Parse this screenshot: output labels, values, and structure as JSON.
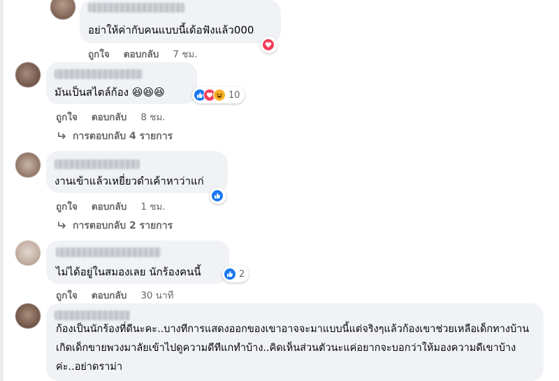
{
  "comments": [
    {
      "text": "อย่าให้ค่ากับคนแบบนี้เด้อฟังแล้ว000",
      "like_label": "ถูกใจ",
      "reply_label": "ตอบกลับ",
      "time": "7 ชม.",
      "reactions": {
        "icons": [
          "love-icon"
        ],
        "count": ""
      }
    },
    {
      "text": "มันเป็นสไตล์ก้อง 😆😆😆",
      "like_label": "ถูกใจ",
      "reply_label": "ตอบกลับ",
      "time": "8 ชม.",
      "reactions": {
        "icons": [
          "like-icon",
          "love-icon",
          "haha-icon"
        ],
        "count": "10"
      },
      "replies_label": "การตอบกลับ 4 รายการ"
    },
    {
      "text": "งานเข้าแล้วเหยี่ยวดำเค้าหาว่าแก่",
      "like_label": "ถูกใจ",
      "reply_label": "ตอบกลับ",
      "time": "1 ชม.",
      "reactions": {
        "icons": [
          "like-icon"
        ],
        "count": ""
      },
      "replies_label": "การตอบกลับ 2 รายการ"
    },
    {
      "text": "ไม่ได้อยู่ในสมองเลย นักร้องคนนี้",
      "like_label": "ถูกใจ",
      "reply_label": "ตอบกลับ",
      "time": "30 นาที",
      "reactions": {
        "icons": [
          "like-icon"
        ],
        "count": "2"
      }
    },
    {
      "text": "ก้องเป็นนักร้องที่ดีนะคะ..บางทีการแสดงออกของเขาอาจจะมาแบบนี้แต่จริงๆแล้วก้องเขาช่วยเหลือเด็กทางบ้านเกิดเด็กขายพวงมาลัยเข้าไปดูความดีทีแกทำบ้าง..คิดเห็นส่วนตัวนะแค่อยากจะบอกว่าให้มองความดีเขาบ้างค่ะ..อย่าดราม่า"
    }
  ],
  "colors": {
    "bubble": "#f0f2f5",
    "meta_text": "#65676b",
    "like": "#1877f2",
    "love": "#f33e58",
    "haha": "#f7b125"
  }
}
